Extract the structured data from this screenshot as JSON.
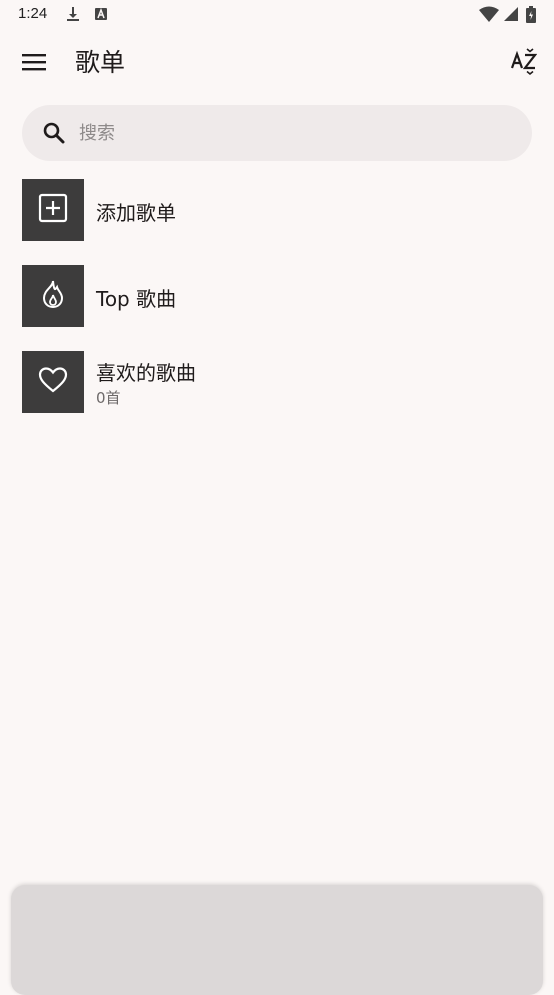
{
  "status_bar": {
    "time": "1:24",
    "icons": [
      "download-icon",
      "font-badge-icon",
      "wifi-icon",
      "signal-icon",
      "battery-icon"
    ]
  },
  "app_bar": {
    "title": "歌单",
    "menu_icon": "hamburger-menu-icon",
    "sort_icon": "sort-az-icon"
  },
  "search": {
    "placeholder": "搜索",
    "value": ""
  },
  "playlists": [
    {
      "title": "添加歌单",
      "subtitle": "",
      "icon": "add-box-icon"
    },
    {
      "title": "Top 歌曲",
      "subtitle": "",
      "icon": "flame-icon"
    },
    {
      "title": "喜欢的歌曲",
      "subtitle": "0首",
      "icon": "heart-icon"
    }
  ],
  "colors": {
    "background": "#fbf7f6",
    "search_bg": "#efeaea",
    "thumb_bg": "#3d3c3c",
    "bottom_sheet": "#dcd8d8"
  }
}
